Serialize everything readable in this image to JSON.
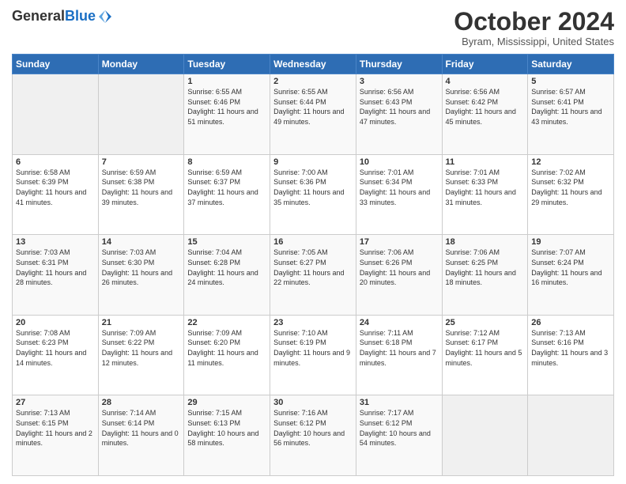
{
  "logo": {
    "general": "General",
    "blue": "Blue"
  },
  "header": {
    "month": "October 2024",
    "location": "Byram, Mississippi, United States"
  },
  "weekdays": [
    "Sunday",
    "Monday",
    "Tuesday",
    "Wednesday",
    "Thursday",
    "Friday",
    "Saturday"
  ],
  "weeks": [
    [
      {
        "day": "",
        "empty": true
      },
      {
        "day": "",
        "empty": true
      },
      {
        "day": "1",
        "sunrise": "6:55 AM",
        "sunset": "6:46 PM",
        "daylight": "11 hours and 51 minutes."
      },
      {
        "day": "2",
        "sunrise": "6:55 AM",
        "sunset": "6:44 PM",
        "daylight": "11 hours and 49 minutes."
      },
      {
        "day": "3",
        "sunrise": "6:56 AM",
        "sunset": "6:43 PM",
        "daylight": "11 hours and 47 minutes."
      },
      {
        "day": "4",
        "sunrise": "6:56 AM",
        "sunset": "6:42 PM",
        "daylight": "11 hours and 45 minutes."
      },
      {
        "day": "5",
        "sunrise": "6:57 AM",
        "sunset": "6:41 PM",
        "daylight": "11 hours and 43 minutes."
      }
    ],
    [
      {
        "day": "6",
        "sunrise": "6:58 AM",
        "sunset": "6:39 PM",
        "daylight": "11 hours and 41 minutes."
      },
      {
        "day": "7",
        "sunrise": "6:59 AM",
        "sunset": "6:38 PM",
        "daylight": "11 hours and 39 minutes."
      },
      {
        "day": "8",
        "sunrise": "6:59 AM",
        "sunset": "6:37 PM",
        "daylight": "11 hours and 37 minutes."
      },
      {
        "day": "9",
        "sunrise": "7:00 AM",
        "sunset": "6:36 PM",
        "daylight": "11 hours and 35 minutes."
      },
      {
        "day": "10",
        "sunrise": "7:01 AM",
        "sunset": "6:34 PM",
        "daylight": "11 hours and 33 minutes."
      },
      {
        "day": "11",
        "sunrise": "7:01 AM",
        "sunset": "6:33 PM",
        "daylight": "11 hours and 31 minutes."
      },
      {
        "day": "12",
        "sunrise": "7:02 AM",
        "sunset": "6:32 PM",
        "daylight": "11 hours and 29 minutes."
      }
    ],
    [
      {
        "day": "13",
        "sunrise": "7:03 AM",
        "sunset": "6:31 PM",
        "daylight": "11 hours and 28 minutes."
      },
      {
        "day": "14",
        "sunrise": "7:03 AM",
        "sunset": "6:30 PM",
        "daylight": "11 hours and 26 minutes."
      },
      {
        "day": "15",
        "sunrise": "7:04 AM",
        "sunset": "6:28 PM",
        "daylight": "11 hours and 24 minutes."
      },
      {
        "day": "16",
        "sunrise": "7:05 AM",
        "sunset": "6:27 PM",
        "daylight": "11 hours and 22 minutes."
      },
      {
        "day": "17",
        "sunrise": "7:06 AM",
        "sunset": "6:26 PM",
        "daylight": "11 hours and 20 minutes."
      },
      {
        "day": "18",
        "sunrise": "7:06 AM",
        "sunset": "6:25 PM",
        "daylight": "11 hours and 18 minutes."
      },
      {
        "day": "19",
        "sunrise": "7:07 AM",
        "sunset": "6:24 PM",
        "daylight": "11 hours and 16 minutes."
      }
    ],
    [
      {
        "day": "20",
        "sunrise": "7:08 AM",
        "sunset": "6:23 PM",
        "daylight": "11 hours and 14 minutes."
      },
      {
        "day": "21",
        "sunrise": "7:09 AM",
        "sunset": "6:22 PM",
        "daylight": "11 hours and 12 minutes."
      },
      {
        "day": "22",
        "sunrise": "7:09 AM",
        "sunset": "6:20 PM",
        "daylight": "11 hours and 11 minutes."
      },
      {
        "day": "23",
        "sunrise": "7:10 AM",
        "sunset": "6:19 PM",
        "daylight": "11 hours and 9 minutes."
      },
      {
        "day": "24",
        "sunrise": "7:11 AM",
        "sunset": "6:18 PM",
        "daylight": "11 hours and 7 minutes."
      },
      {
        "day": "25",
        "sunrise": "7:12 AM",
        "sunset": "6:17 PM",
        "daylight": "11 hours and 5 minutes."
      },
      {
        "day": "26",
        "sunrise": "7:13 AM",
        "sunset": "6:16 PM",
        "daylight": "11 hours and 3 minutes."
      }
    ],
    [
      {
        "day": "27",
        "sunrise": "7:13 AM",
        "sunset": "6:15 PM",
        "daylight": "11 hours and 2 minutes."
      },
      {
        "day": "28",
        "sunrise": "7:14 AM",
        "sunset": "6:14 PM",
        "daylight": "11 hours and 0 minutes."
      },
      {
        "day": "29",
        "sunrise": "7:15 AM",
        "sunset": "6:13 PM",
        "daylight": "10 hours and 58 minutes."
      },
      {
        "day": "30",
        "sunrise": "7:16 AM",
        "sunset": "6:12 PM",
        "daylight": "10 hours and 56 minutes."
      },
      {
        "day": "31",
        "sunrise": "7:17 AM",
        "sunset": "6:12 PM",
        "daylight": "10 hours and 54 minutes."
      },
      {
        "day": "",
        "empty": true
      },
      {
        "day": "",
        "empty": true
      }
    ]
  ]
}
